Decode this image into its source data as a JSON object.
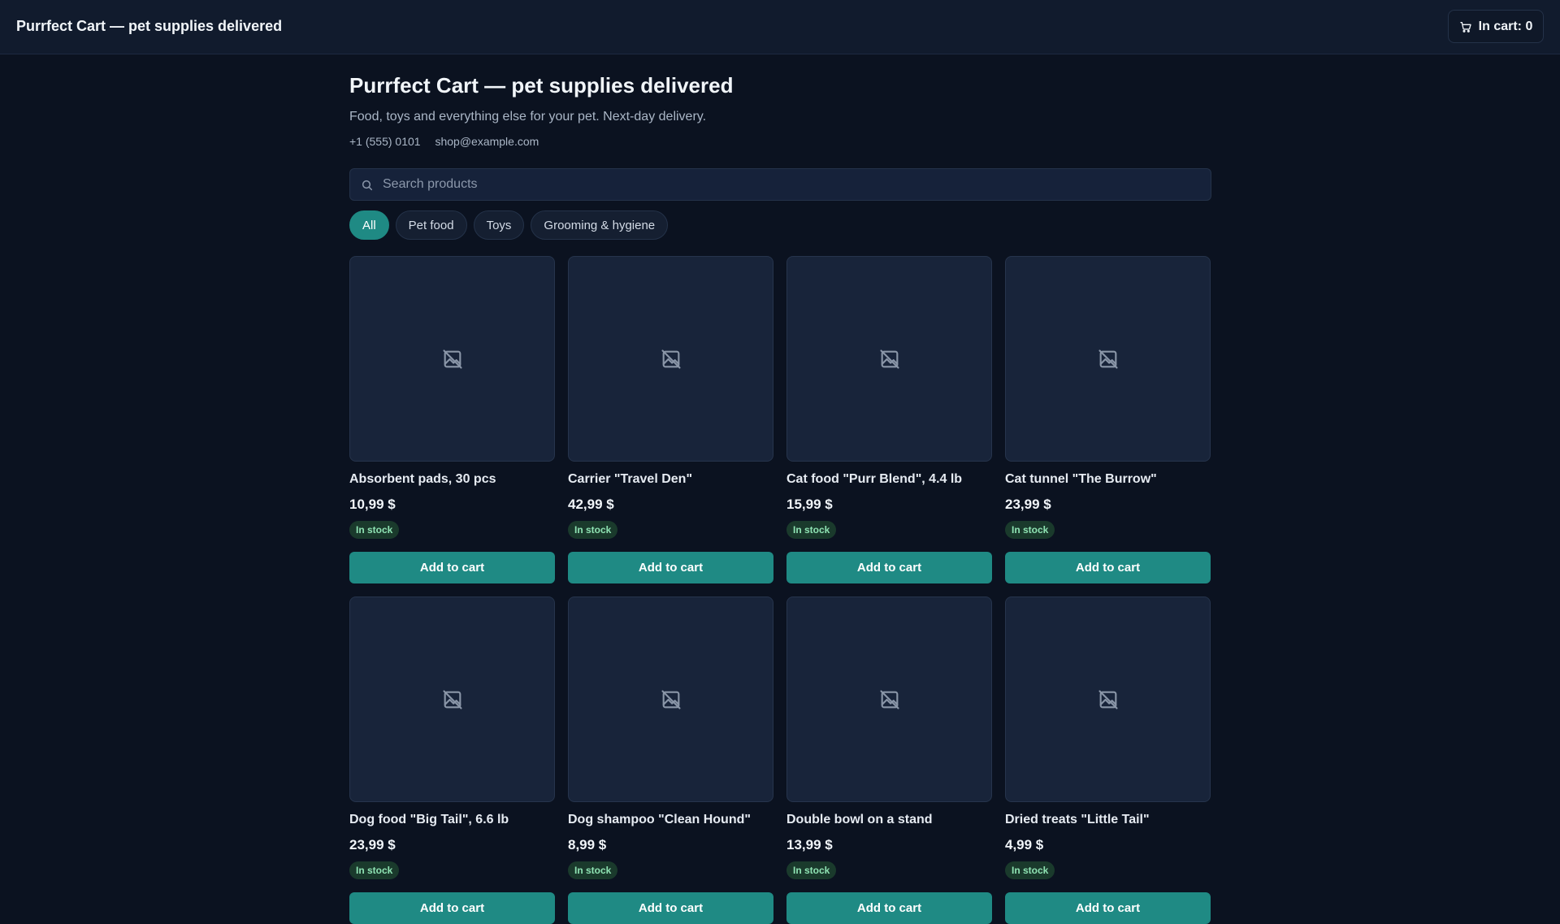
{
  "header": {
    "brand": "Purrfect Cart — pet supplies delivered",
    "cart_label": "In cart: 0",
    "cart_icon": "cart-icon"
  },
  "hero": {
    "title": "Purrfect Cart — pet supplies delivered",
    "subtitle": "Food, toys and everything else for your pet. Next-day delivery.",
    "phone": "+1 (555) 0101",
    "email": "shop@example.com"
  },
  "search": {
    "placeholder": "Search products",
    "icon": "search-icon"
  },
  "filters": [
    {
      "label": "All",
      "active": true
    },
    {
      "label": "Pet food",
      "active": false
    },
    {
      "label": "Toys",
      "active": false
    },
    {
      "label": "Grooming & hygiene",
      "active": false
    }
  ],
  "products": [
    {
      "name": "Absorbent pads, 30 pcs",
      "price": "10,99 $",
      "stock": "In stock",
      "button": "Add to cart"
    },
    {
      "name": "Carrier \"Travel Den\"",
      "price": "42,99 $",
      "stock": "In stock",
      "button": "Add to cart"
    },
    {
      "name": "Cat food \"Purr Blend\", 4.4 lb",
      "price": "15,99 $",
      "stock": "In stock",
      "button": "Add to cart"
    },
    {
      "name": "Cat tunnel \"The Burrow\"",
      "price": "23,99 $",
      "stock": "In stock",
      "button": "Add to cart"
    },
    {
      "name": "Dog food \"Big Tail\", 6.6 lb",
      "price": "23,99 $",
      "stock": "In stock",
      "button": "Add to cart"
    },
    {
      "name": "Dog shampoo \"Clean Hound\"",
      "price": "8,99 $",
      "stock": "In stock",
      "button": "Add to cart"
    },
    {
      "name": "Double bowl on a stand",
      "price": "13,99 $",
      "stock": "In stock",
      "button": "Add to cart"
    },
    {
      "name": "Dried treats \"Little Tail\"",
      "price": "4,99 $",
      "stock": "In stock",
      "button": "Add to cart"
    }
  ],
  "colors": {
    "accent": "#1f8a84",
    "background": "#0b1220",
    "stock_badge": "#1a3a2c"
  }
}
